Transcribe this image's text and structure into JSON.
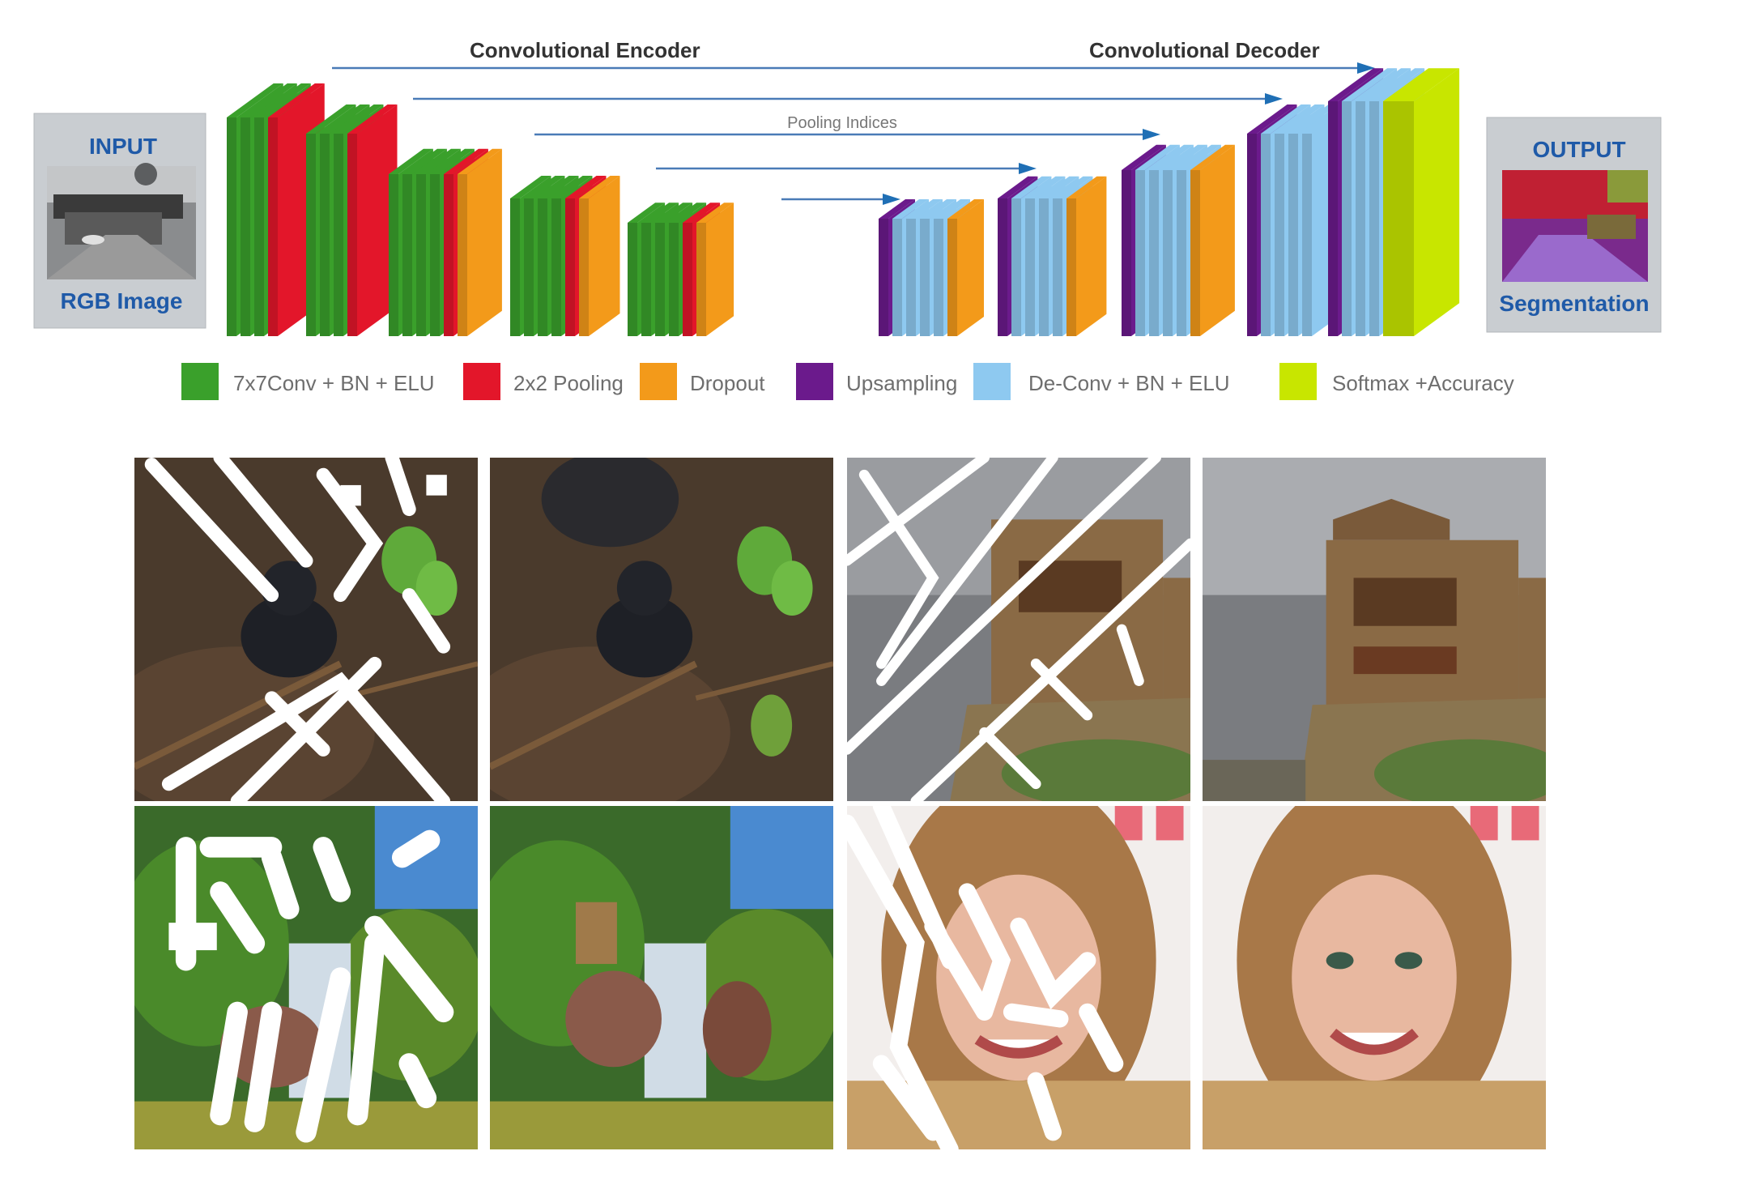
{
  "architecture": {
    "encoder_title": "Convolutional Encoder",
    "decoder_title": "Convolutional Decoder",
    "pooling_label": "Pooling Indices",
    "input_title": "INPUT",
    "input_caption": "RGB Image",
    "output_title": "OUTPUT",
    "output_caption": "Segmentation"
  },
  "legend": [
    {
      "label": "7x7Conv + BN + ELU",
      "color": "#3aa02b"
    },
    {
      "label": "2x2 Pooling",
      "color": "#e3162a"
    },
    {
      "label": "Dropout",
      "color": "#f39a1a"
    },
    {
      "label": "Upsampling",
      "color": "#6b1a8c"
    },
    {
      "label": "De-Conv + BN + ELU",
      "color": "#8ec9f0"
    },
    {
      "label": "Softmax +Accuracy",
      "color": "#c8e600"
    }
  ],
  "examples": [
    {
      "subject": "beetle",
      "pair": [
        "masked",
        "restored"
      ]
    },
    {
      "subject": "building",
      "pair": [
        "masked",
        "restored"
      ]
    },
    {
      "subject": "waterfall",
      "pair": [
        "masked",
        "restored"
      ]
    },
    {
      "subject": "face",
      "pair": [
        "masked",
        "restored"
      ]
    }
  ]
}
